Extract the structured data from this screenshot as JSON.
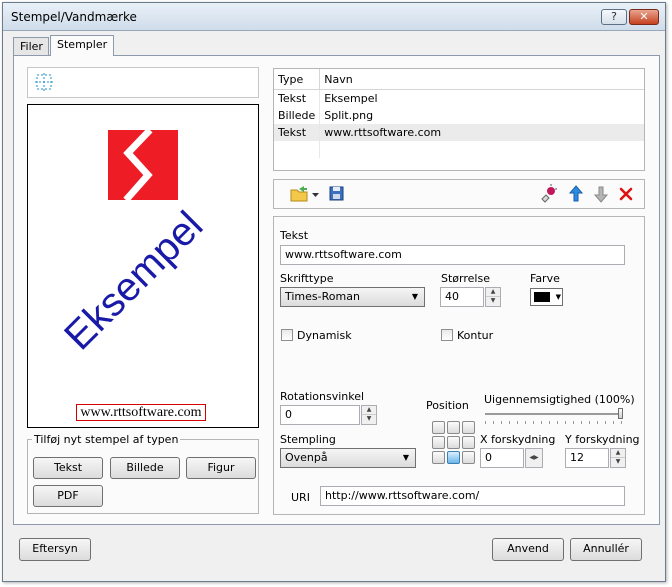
{
  "window": {
    "title": "Stempel/Vandmærke",
    "help_label": "?",
    "close_label": "✕"
  },
  "tabs": [
    {
      "label": "Filer",
      "active": false
    },
    {
      "label": "Stempler",
      "active": true
    }
  ],
  "preview": {
    "stamp_text": "Eksempel",
    "url_text": "www.rttsoftware.com",
    "text_color": "#1a1aa8",
    "logo_color": "#ee1c25"
  },
  "add_stamp": {
    "group_label": "Tilføj nyt stempel af typen",
    "buttons": {
      "text": "Tekst",
      "image": "Billede",
      "shape": "Figur",
      "pdf": "PDF"
    }
  },
  "stamp_list": {
    "columns": {
      "type": "Type",
      "name": "Navn"
    },
    "rows": [
      {
        "type": "Tekst",
        "name": "Eksempel",
        "selected": false
      },
      {
        "type": "Billede",
        "name": "Split.png",
        "selected": false
      },
      {
        "type": "Tekst",
        "name": "www.rttsoftware.com",
        "selected": true
      }
    ]
  },
  "toolbar": {
    "icons": [
      "open-folder-icon",
      "save-icon",
      "edit-stamp-icon",
      "move-up-icon",
      "move-down-icon",
      "delete-icon"
    ]
  },
  "properties": {
    "text_label": "Tekst",
    "text_value": "www.rttsoftware.com",
    "font_label": "Skrifttype",
    "font_value": "Times-Roman",
    "size_label": "Størrelse",
    "size_value": "40",
    "color_label": "Farve",
    "color_value": "#000000",
    "dynamic_label": "Dynamisk",
    "outline_label": "Kontur",
    "rotation_label": "Rotationsvinkel",
    "rotation_value": "0",
    "position_label": "Position",
    "position_selected": 7,
    "opacity_label": "Uigennemsigtighed (100%)",
    "opacity_value": 1.0,
    "stamping_label": "Stempling",
    "stamping_value": "Ovenpå",
    "x_offset_label": "X forskydning",
    "x_offset_value": "0",
    "y_offset_label": "Y forskydning",
    "y_offset_value": "12",
    "uri_label": "URI",
    "uri_value": "http://www.rttsoftware.com/"
  },
  "footer": {
    "preview_button": "Eftersyn",
    "apply_button": "Anvend",
    "cancel_button": "Annullér"
  }
}
